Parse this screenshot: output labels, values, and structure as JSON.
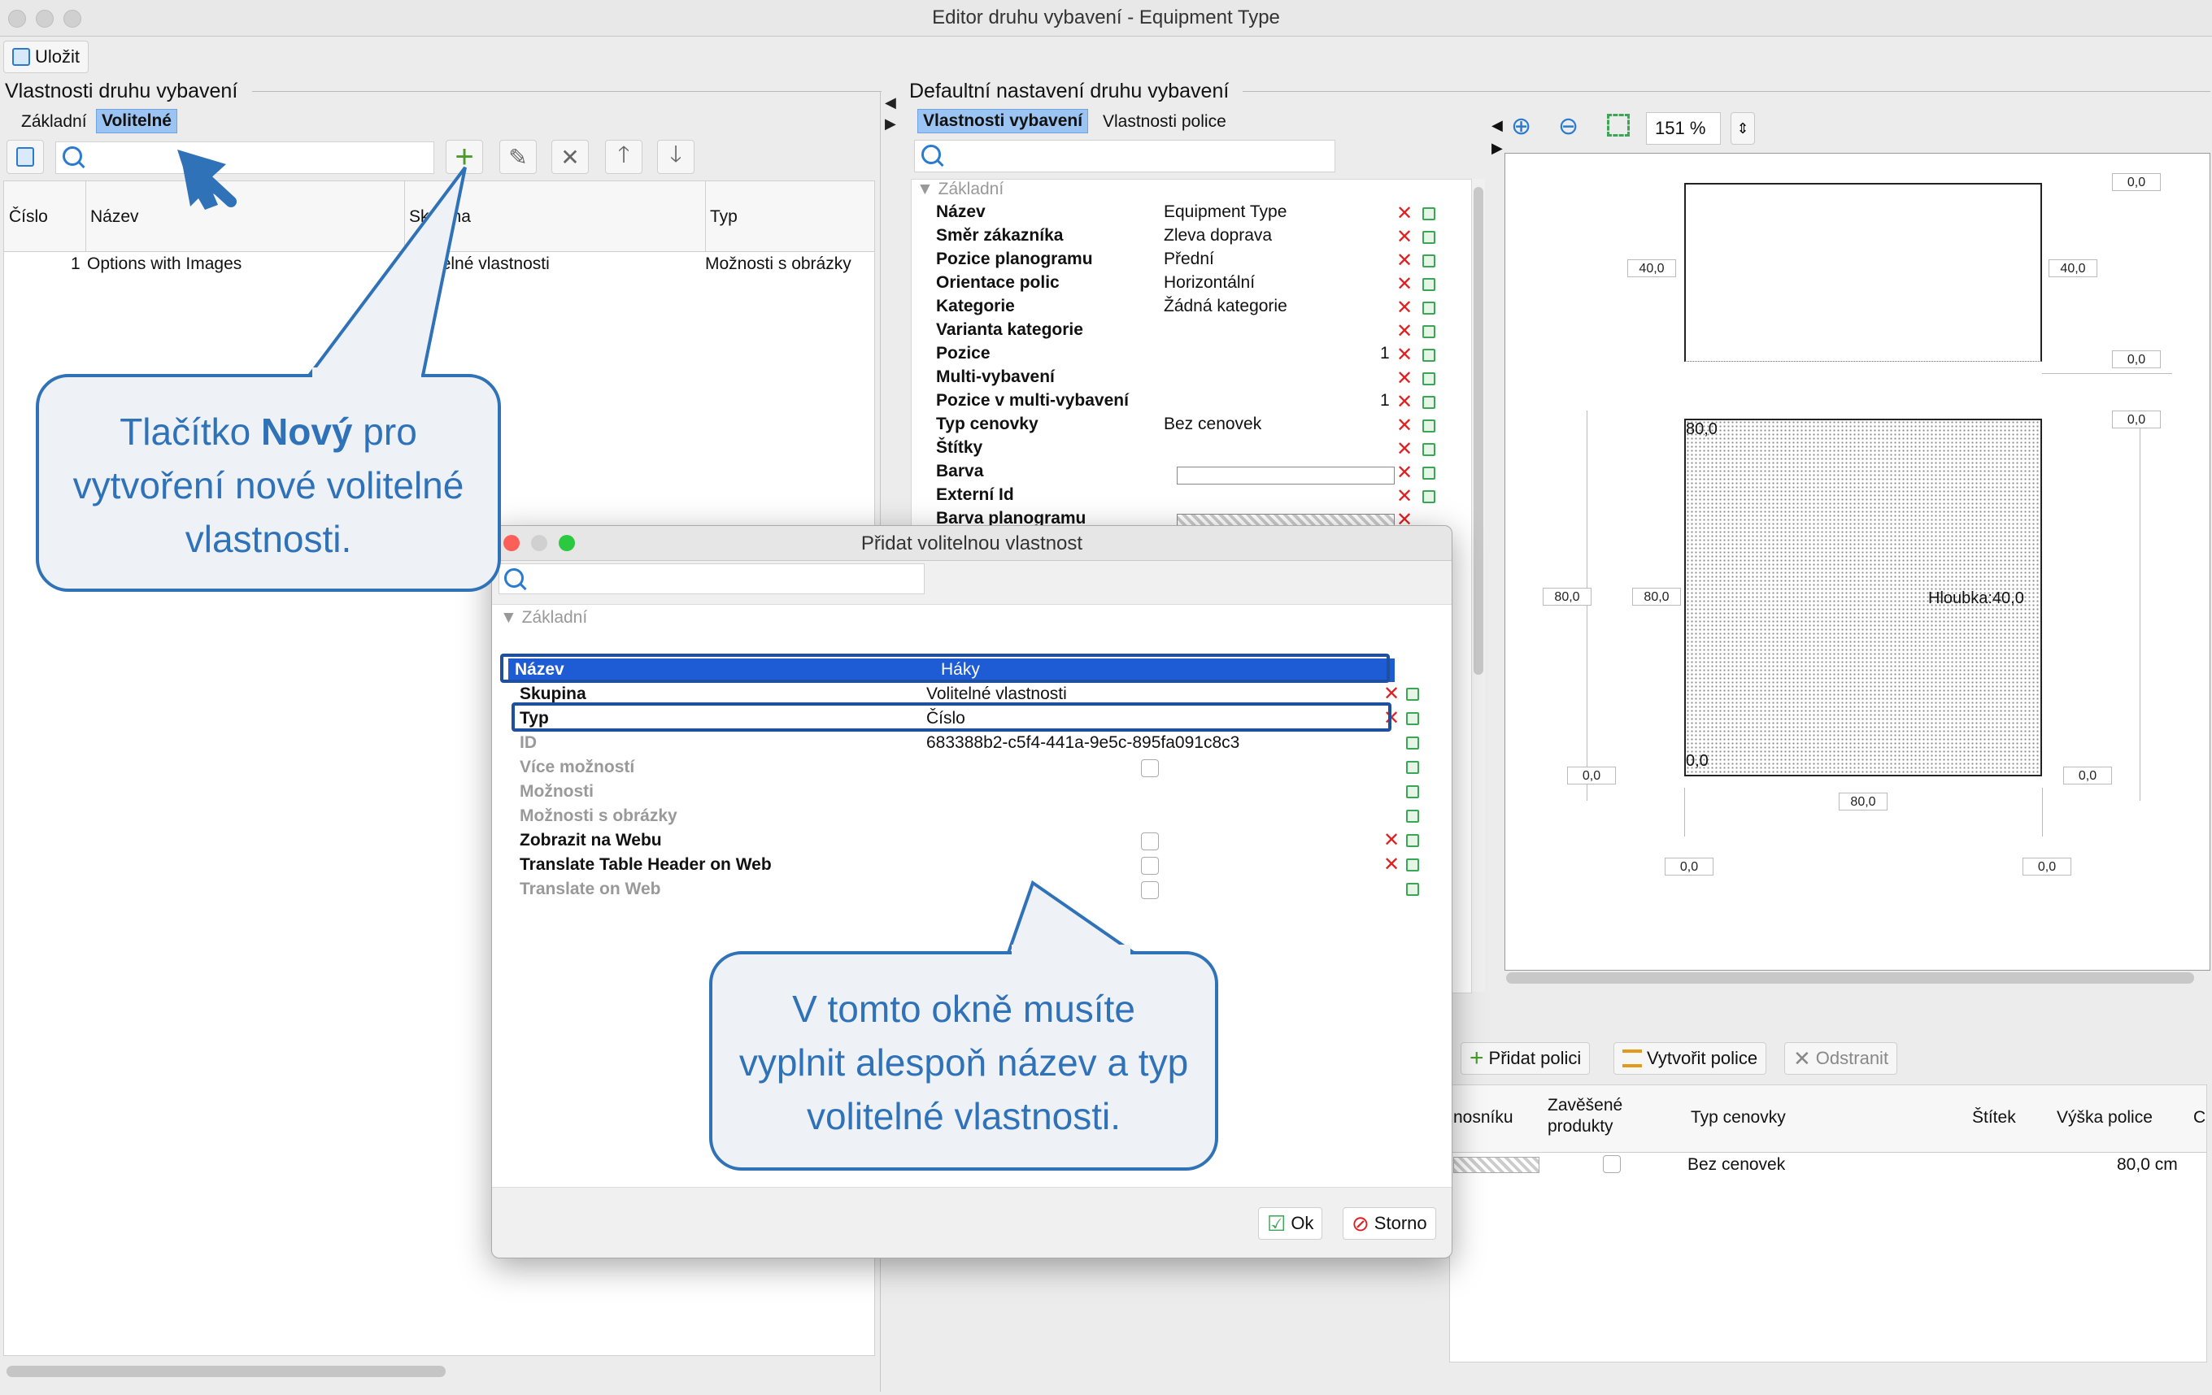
{
  "window": {
    "title": "Editor druhu vybavení - Equipment Type"
  },
  "toolbar": {
    "save_label": "Uložit"
  },
  "left": {
    "section_title": "Vlastnosti druhu vybavení",
    "tabs": [
      "Základní",
      "Volitelné"
    ],
    "columns": [
      "Číslo",
      "Název",
      "Skupina",
      "Typ"
    ],
    "rows": [
      {
        "num": "1",
        "name": "Options with Images",
        "group": "Volitelné vlastnosti",
        "type": "Možnosti s obrázky"
      }
    ]
  },
  "right": {
    "section_title": "Defaultní nastavení druhu vybavení",
    "tabs": [
      "Vlastnosti vybavení",
      "Vlastnosti police"
    ],
    "group": "Základní",
    "props": [
      {
        "name": "Název",
        "value": "Equipment Type"
      },
      {
        "name": "Směr zákazníka",
        "value": "Zleva doprava"
      },
      {
        "name": "Pozice planogramu",
        "value": "Přední"
      },
      {
        "name": "Orientace polic",
        "value": "Horizontální"
      },
      {
        "name": "Kategorie",
        "value": "Žádná kategorie"
      },
      {
        "name": "Varianta kategorie",
        "value": ""
      },
      {
        "name": "Pozice",
        "value": "1"
      },
      {
        "name": "Multi-vybavení",
        "value": ""
      },
      {
        "name": "Pozice v multi-vybavení",
        "value": "1"
      },
      {
        "name": "Typ cenovky",
        "value": "Bez cenovek"
      },
      {
        "name": "Štítky",
        "value": ""
      },
      {
        "name": "Barva",
        "value": ""
      },
      {
        "name": "Externí Id",
        "value": ""
      },
      {
        "name": "Barva planogramu",
        "value": ""
      }
    ]
  },
  "preview": {
    "zoom": "151 %",
    "labels": {
      "top_right1": "0,0",
      "left_40": "40,0",
      "right_40": "40,0",
      "right_00b": "0,0",
      "right_00c": "0,0",
      "top_80": "80,0",
      "left_80a": "80,0",
      "left_80b": "80,0",
      "depth": "Hloubka:40,0",
      "origin": "0,0",
      "left_00": "0,0",
      "right_00d": "0,0",
      "bottom_80": "80,0",
      "bl_00": "0,0",
      "br_00": "0,0"
    }
  },
  "shelves": {
    "add_label": "Přidat polici",
    "create_label": "Vytvořit police",
    "remove_label": "Odstranit",
    "columns": [
      "nosníku",
      "Zavěšené produkty",
      "Typ cenovky",
      "Štítek",
      "Výška police",
      "C"
    ],
    "row": {
      "price_type": "Bez cenovek",
      "height": "80,0 cm"
    }
  },
  "dialog": {
    "title": "Přidat volitelnou vlastnost",
    "group": "Základní",
    "rows": [
      {
        "name": "Název",
        "value": "Háky"
      },
      {
        "name": "Skupina",
        "value": "Volitelné vlastnosti"
      },
      {
        "name": "Typ",
        "value": "Číslo"
      },
      {
        "name": "ID",
        "value": "683388b2-c5f4-441a-9e5c-895fa091c8c3"
      },
      {
        "name": "Více možností",
        "value": ""
      },
      {
        "name": "Možnosti",
        "value": ""
      },
      {
        "name": "Možnosti s obrázky",
        "value": ""
      },
      {
        "name": "Zobrazit na Webu",
        "value": ""
      },
      {
        "name": "Translate Table Header on Web",
        "value": ""
      },
      {
        "name": "Translate on Web",
        "value": ""
      }
    ],
    "ok_label": "Ok",
    "cancel_label": "Storno"
  },
  "callouts": {
    "new_button_pre": "Tlačítko ",
    "new_button_bold": "Nový",
    "new_button_post": " pro vytvoření nové volitelné vlastnosti.",
    "dialog_hint": "V tomto okně musíte vyplnit alespoň název a typ volitelné vlastnosti."
  },
  "colors": {
    "accent": "#2f72b8",
    "selection": "#1e5cd6",
    "tab_selected": "#9cc4f2"
  }
}
